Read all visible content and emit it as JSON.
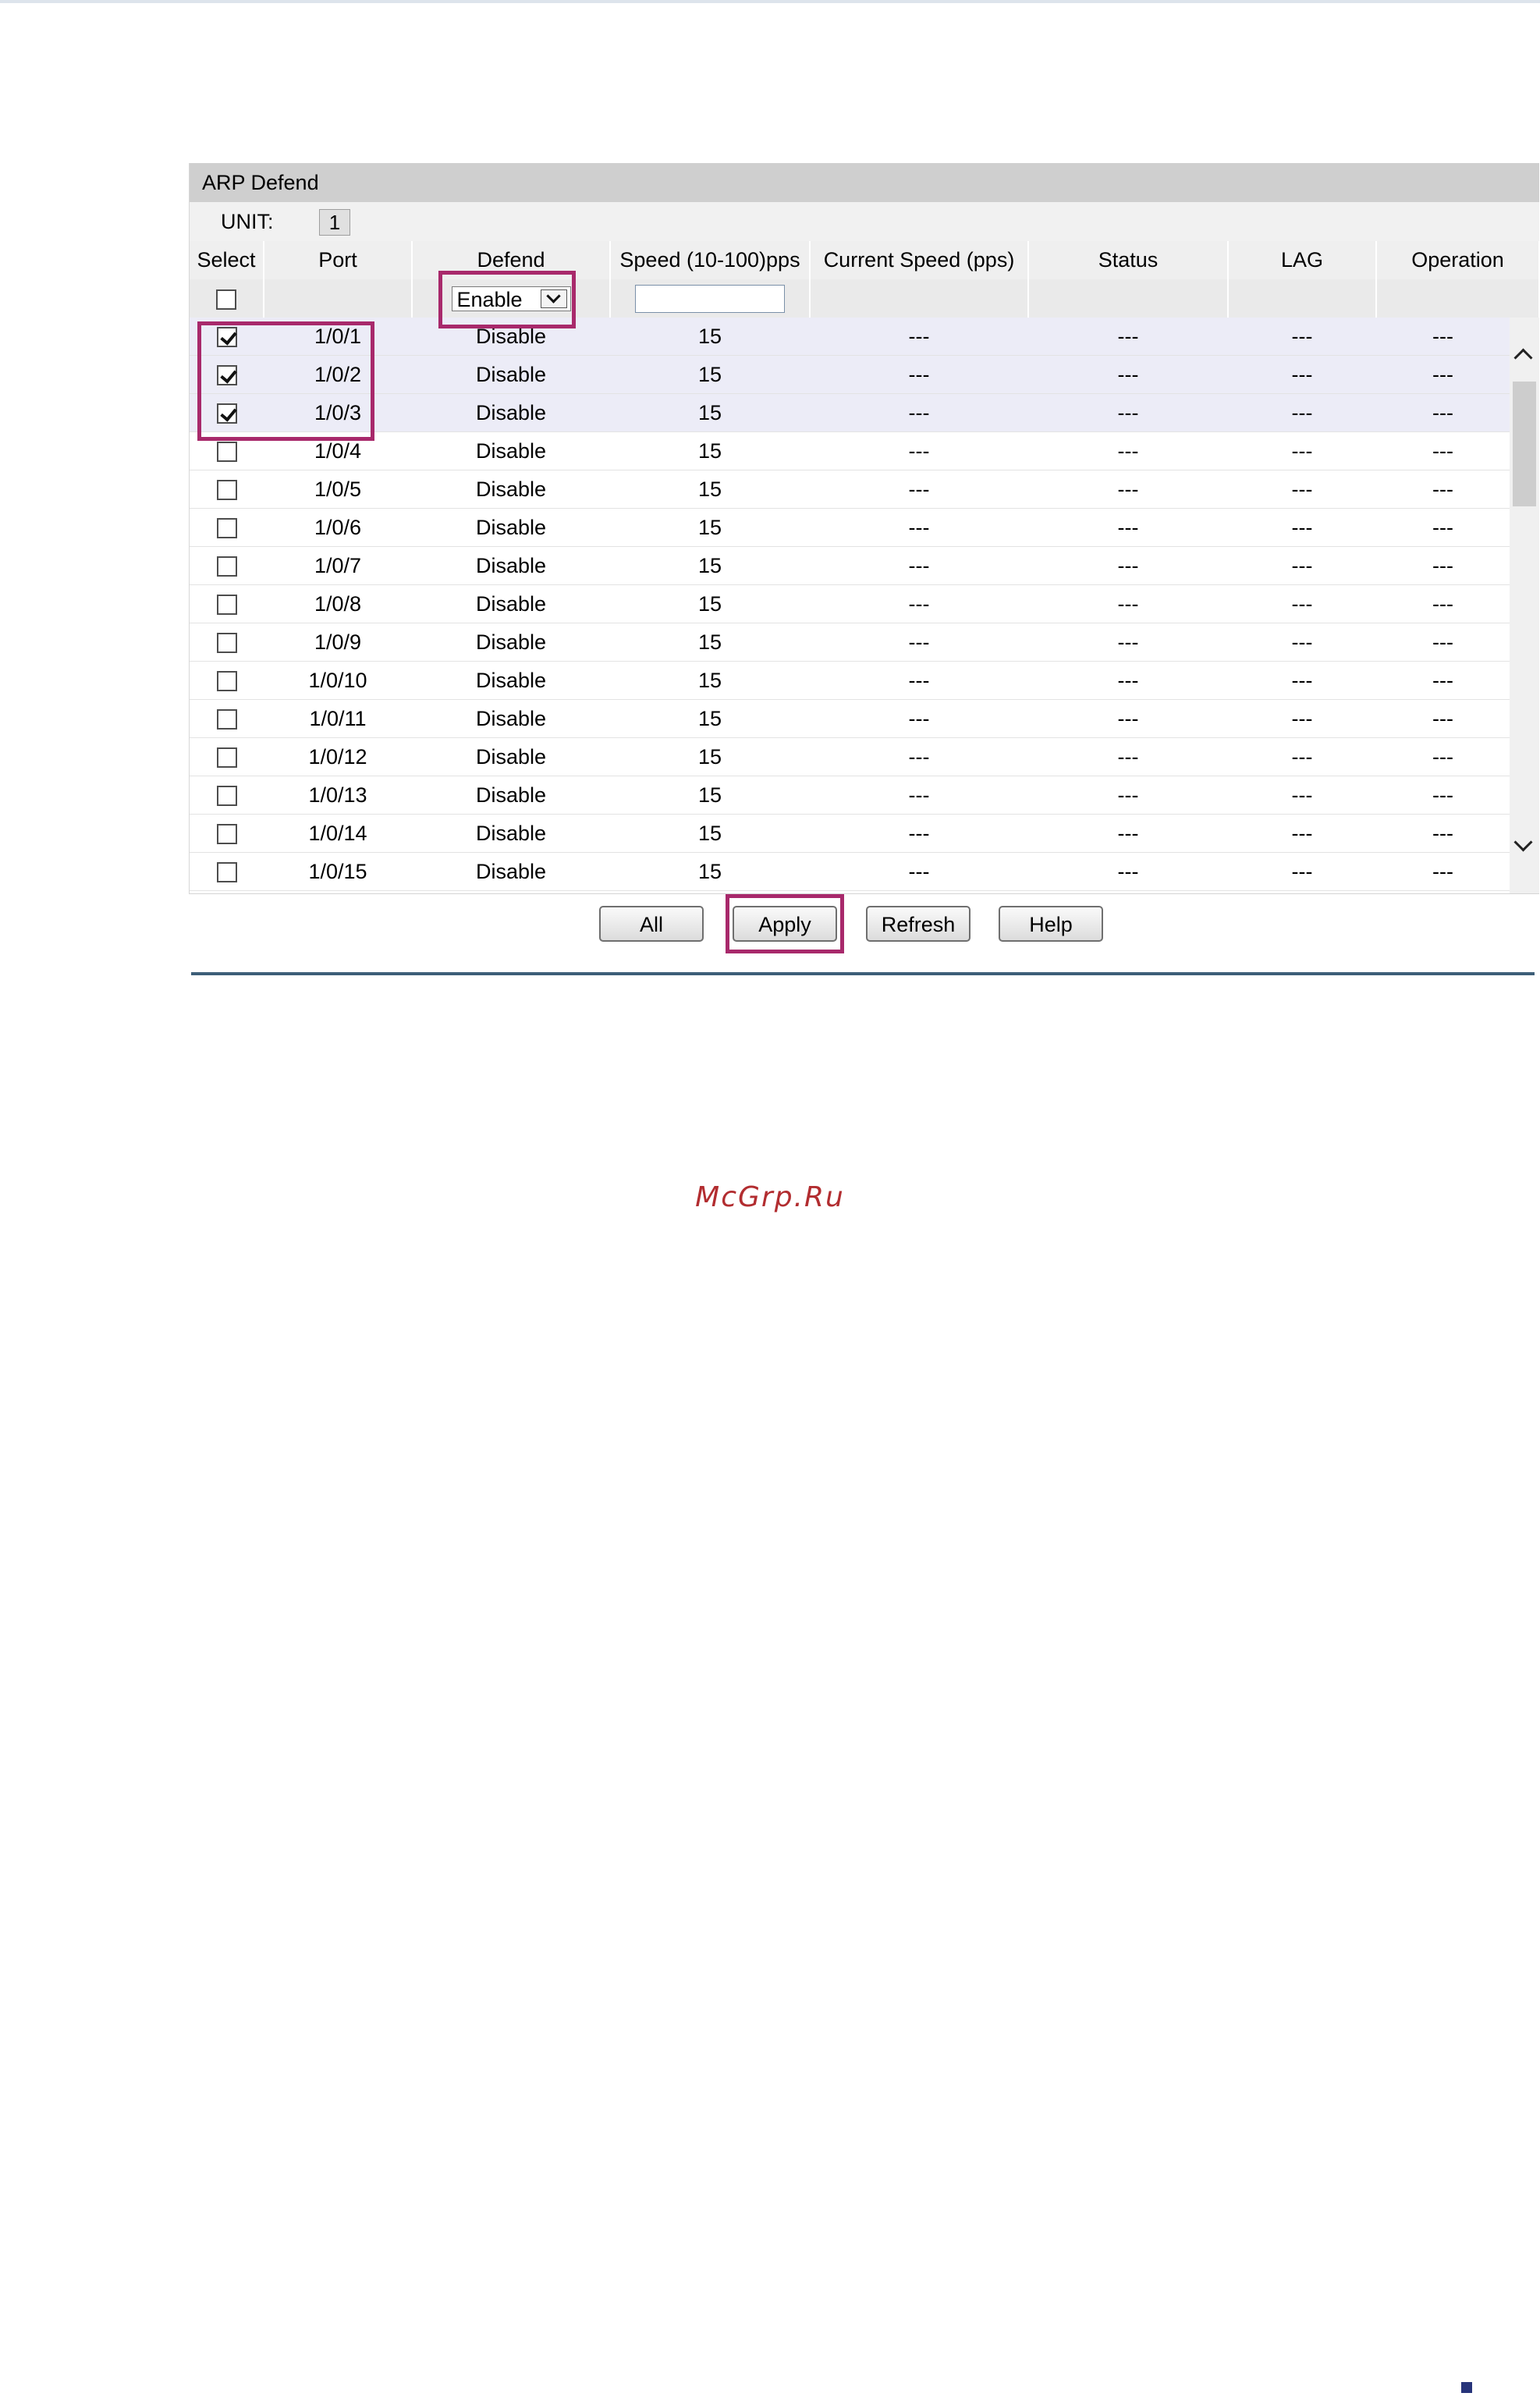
{
  "panel": {
    "title": "ARP Defend",
    "unit_label": "UNIT:",
    "unit_value": "1"
  },
  "columns": [
    "Select",
    "Port",
    "Defend",
    "Speed (10-100)pps",
    "Current Speed (pps)",
    "Status",
    "LAG",
    "Operation"
  ],
  "filter": {
    "select_checked": false,
    "defend_value": "Enable",
    "speed_value": ""
  },
  "rows": [
    {
      "checked": true,
      "port": "1/0/1",
      "defend": "Disable",
      "speed": "15",
      "current_speed": "---",
      "status": "---",
      "lag": "---",
      "operation": "---"
    },
    {
      "checked": true,
      "port": "1/0/2",
      "defend": "Disable",
      "speed": "15",
      "current_speed": "---",
      "status": "---",
      "lag": "---",
      "operation": "---"
    },
    {
      "checked": true,
      "port": "1/0/3",
      "defend": "Disable",
      "speed": "15",
      "current_speed": "---",
      "status": "---",
      "lag": "---",
      "operation": "---"
    },
    {
      "checked": false,
      "port": "1/0/4",
      "defend": "Disable",
      "speed": "15",
      "current_speed": "---",
      "status": "---",
      "lag": "---",
      "operation": "---"
    },
    {
      "checked": false,
      "port": "1/0/5",
      "defend": "Disable",
      "speed": "15",
      "current_speed": "---",
      "status": "---",
      "lag": "---",
      "operation": "---"
    },
    {
      "checked": false,
      "port": "1/0/6",
      "defend": "Disable",
      "speed": "15",
      "current_speed": "---",
      "status": "---",
      "lag": "---",
      "operation": "---"
    },
    {
      "checked": false,
      "port": "1/0/7",
      "defend": "Disable",
      "speed": "15",
      "current_speed": "---",
      "status": "---",
      "lag": "---",
      "operation": "---"
    },
    {
      "checked": false,
      "port": "1/0/8",
      "defend": "Disable",
      "speed": "15",
      "current_speed": "---",
      "status": "---",
      "lag": "---",
      "operation": "---"
    },
    {
      "checked": false,
      "port": "1/0/9",
      "defend": "Disable",
      "speed": "15",
      "current_speed": "---",
      "status": "---",
      "lag": "---",
      "operation": "---"
    },
    {
      "checked": false,
      "port": "1/0/10",
      "defend": "Disable",
      "speed": "15",
      "current_speed": "---",
      "status": "---",
      "lag": "---",
      "operation": "---"
    },
    {
      "checked": false,
      "port": "1/0/11",
      "defend": "Disable",
      "speed": "15",
      "current_speed": "---",
      "status": "---",
      "lag": "---",
      "operation": "---"
    },
    {
      "checked": false,
      "port": "1/0/12",
      "defend": "Disable",
      "speed": "15",
      "current_speed": "---",
      "status": "---",
      "lag": "---",
      "operation": "---"
    },
    {
      "checked": false,
      "port": "1/0/13",
      "defend": "Disable",
      "speed": "15",
      "current_speed": "---",
      "status": "---",
      "lag": "---",
      "operation": "---"
    },
    {
      "checked": false,
      "port": "1/0/14",
      "defend": "Disable",
      "speed": "15",
      "current_speed": "---",
      "status": "---",
      "lag": "---",
      "operation": "---"
    },
    {
      "checked": false,
      "port": "1/0/15",
      "defend": "Disable",
      "speed": "15",
      "current_speed": "---",
      "status": "---",
      "lag": "---",
      "operation": "---"
    }
  ],
  "buttons": {
    "all": "All",
    "apply": "Apply",
    "refresh": "Refresh",
    "help": "Help"
  },
  "watermark": "McGrp.Ru",
  "colors": {
    "highlight": "#a8296b",
    "selected_row": "#ececf7",
    "title_bar": "#cfcfcf",
    "rule": "#3d5e78",
    "watermark": "#b22d30"
  },
  "icons": {
    "dropdown": "chevron-down-icon",
    "scroll_up": "chevron-up-icon",
    "scroll_down": "chevron-down-icon",
    "checked": "checkmark-icon"
  }
}
